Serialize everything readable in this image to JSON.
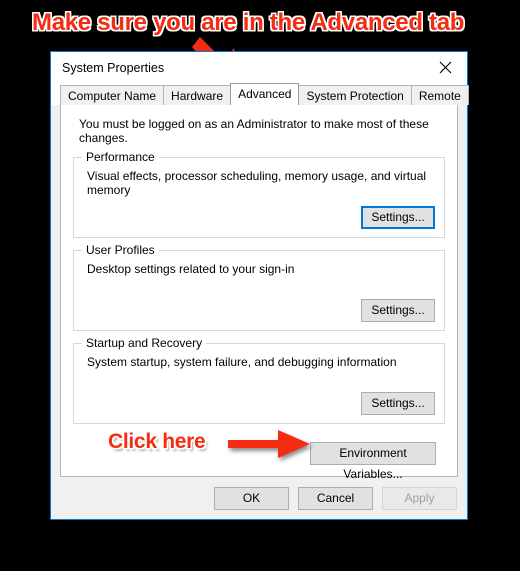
{
  "annotations": {
    "top_note": "Make sure you are in the Advanced tab",
    "click_note": "Click here",
    "arrow_color": "#f42d12"
  },
  "window": {
    "title": "System Properties",
    "close_icon": "close-icon",
    "accent_color": "#0078d7"
  },
  "tabs": [
    {
      "label": "Computer Name",
      "selected": false
    },
    {
      "label": "Hardware",
      "selected": false
    },
    {
      "label": "Advanced",
      "selected": true
    },
    {
      "label": "System Protection",
      "selected": false
    },
    {
      "label": "Remote",
      "selected": false
    }
  ],
  "content": {
    "admin_note": "You must be logged on as an Administrator to make most of these changes.",
    "groups": [
      {
        "legend": "Performance",
        "description": "Visual effects, processor scheduling, memory usage, and virtual memory",
        "button": "Settings...",
        "focused": true
      },
      {
        "legend": "User Profiles",
        "description": "Desktop settings related to your sign-in",
        "button": "Settings...",
        "focused": false
      },
      {
        "legend": "Startup and Recovery",
        "description": "System startup, system failure, and debugging information",
        "button": "Settings...",
        "focused": false
      }
    ],
    "environment_button": "Environment Variables..."
  },
  "footer": {
    "ok": "OK",
    "cancel": "Cancel",
    "apply": "Apply",
    "apply_disabled": true
  }
}
